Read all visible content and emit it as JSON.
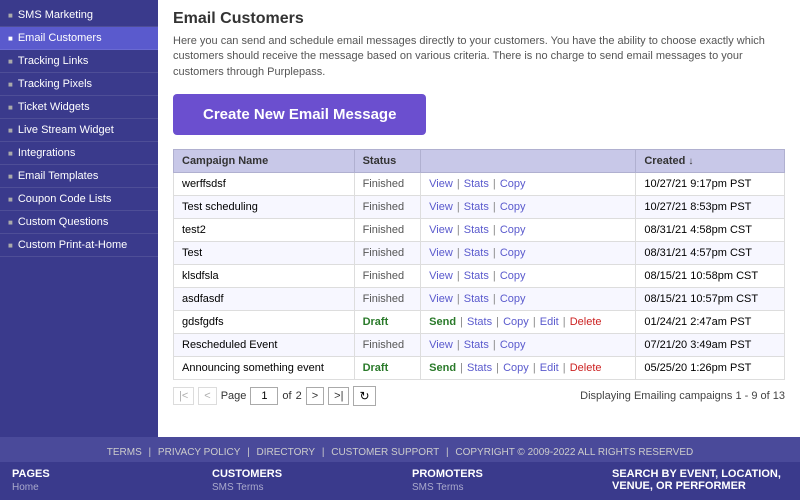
{
  "sidebar": {
    "items": [
      {
        "label": "SMS Marketing",
        "active": false,
        "id": "sms-marketing"
      },
      {
        "label": "Email Customers",
        "active": true,
        "id": "email-customers"
      },
      {
        "label": "Tracking Links",
        "active": false,
        "id": "tracking-links"
      },
      {
        "label": "Tracking Pixels",
        "active": false,
        "id": "tracking-pixels"
      },
      {
        "label": "Ticket Widgets",
        "active": false,
        "id": "ticket-widgets"
      },
      {
        "label": "Live Stream Widget",
        "active": false,
        "id": "live-stream-widget"
      },
      {
        "label": "Integrations",
        "active": false,
        "id": "integrations"
      },
      {
        "label": "Email Templates",
        "active": false,
        "id": "email-templates"
      },
      {
        "label": "Coupon Code Lists",
        "active": false,
        "id": "coupon-code-lists"
      },
      {
        "label": "Custom Questions",
        "active": false,
        "id": "custom-questions"
      },
      {
        "label": "Custom Print-at-Home",
        "active": false,
        "id": "custom-print-at-home"
      }
    ]
  },
  "page": {
    "title": "Email Customers",
    "description": "Here you can send and schedule email messages directly to your customers. You have the ability to choose exactly which customers should receive the message based on various criteria. There is no charge to send email messages to your customers through Purplepass.",
    "create_button": "Create New Email Message"
  },
  "table": {
    "headers": [
      {
        "label": "Campaign Name",
        "id": "col-name"
      },
      {
        "label": "Status",
        "id": "col-status"
      },
      {
        "label": "",
        "id": "col-actions"
      },
      {
        "label": "Created ↓",
        "id": "col-created"
      }
    ],
    "rows": [
      {
        "name": "werffsdsf",
        "status": "Finished",
        "status_type": "finished",
        "actions": [
          {
            "label": "View",
            "type": "link"
          },
          {
            "label": "Stats",
            "type": "link"
          },
          {
            "label": "Copy",
            "type": "link"
          }
        ],
        "created": "10/27/21 9:17pm PST"
      },
      {
        "name": "Test scheduling",
        "status": "Finished",
        "status_type": "finished",
        "actions": [
          {
            "label": "View",
            "type": "link"
          },
          {
            "label": "Stats",
            "type": "link"
          },
          {
            "label": "Copy",
            "type": "link"
          }
        ],
        "created": "10/27/21 8:53pm PST"
      },
      {
        "name": "test2",
        "status": "Finished",
        "status_type": "finished",
        "actions": [
          {
            "label": "View",
            "type": "link"
          },
          {
            "label": "Stats",
            "type": "link"
          },
          {
            "label": "Copy",
            "type": "link"
          }
        ],
        "created": "08/31/21 4:58pm CST"
      },
      {
        "name": "Test",
        "status": "Finished",
        "status_type": "finished",
        "actions": [
          {
            "label": "View",
            "type": "link"
          },
          {
            "label": "Stats",
            "type": "link"
          },
          {
            "label": "Copy",
            "type": "link"
          }
        ],
        "created": "08/31/21 4:57pm CST"
      },
      {
        "name": "klsdfsla",
        "status": "Finished",
        "status_type": "finished",
        "actions": [
          {
            "label": "View",
            "type": "link"
          },
          {
            "label": "Stats",
            "type": "link"
          },
          {
            "label": "Copy",
            "type": "link"
          }
        ],
        "created": "08/15/21 10:58pm CST"
      },
      {
        "name": "asdfasdf",
        "status": "Finished",
        "status_type": "finished",
        "actions": [
          {
            "label": "View",
            "type": "link"
          },
          {
            "label": "Stats",
            "type": "link"
          },
          {
            "label": "Copy",
            "type": "link"
          }
        ],
        "created": "08/15/21 10:57pm CST"
      },
      {
        "name": "gdsfgdfs",
        "status": "Draft",
        "status_type": "draft",
        "actions": [
          {
            "label": "Send",
            "type": "send"
          },
          {
            "label": "Stats",
            "type": "link"
          },
          {
            "label": "Copy",
            "type": "link"
          },
          {
            "label": "Edit",
            "type": "link"
          },
          {
            "label": "Delete",
            "type": "delete"
          }
        ],
        "created": "01/24/21 2:47am PST"
      },
      {
        "name": "Rescheduled Event",
        "status": "Finished",
        "status_type": "finished",
        "actions": [
          {
            "label": "View",
            "type": "link"
          },
          {
            "label": "Stats",
            "type": "link"
          },
          {
            "label": "Copy",
            "type": "link"
          }
        ],
        "created": "07/21/20 3:49am PST"
      },
      {
        "name": "Announcing something event",
        "status": "Draft",
        "status_type": "draft",
        "actions": [
          {
            "label": "Send",
            "type": "send"
          },
          {
            "label": "Stats",
            "type": "link"
          },
          {
            "label": "Copy",
            "type": "link"
          },
          {
            "label": "Edit",
            "type": "link"
          },
          {
            "label": "Delete",
            "type": "delete"
          }
        ],
        "created": "05/25/20 1:26pm PST"
      }
    ]
  },
  "pagination": {
    "page_label": "Page",
    "current_page": "1",
    "of_label": "of",
    "total_pages": "2",
    "display_info": "Displaying Emailing campaigns 1 - 9 of 13"
  },
  "footer": {
    "links": [
      "TERMS",
      "PRIVACY POLICY",
      "DIRECTORY",
      "CUSTOMER SUPPORT",
      "COPYRIGHT © 2009-2022 ALL RIGHTS RESERVED"
    ],
    "columns": [
      {
        "title": "PAGES",
        "sub": "Home"
      },
      {
        "title": "CUSTOMERS",
        "sub": "SMS Terms"
      },
      {
        "title": "PROMOTERS",
        "sub": "SMS Terms"
      },
      {
        "title": "SEARCH BY EVENT, LOCATION, VENUE, OR PERFORMER",
        "sub": ""
      }
    ]
  }
}
